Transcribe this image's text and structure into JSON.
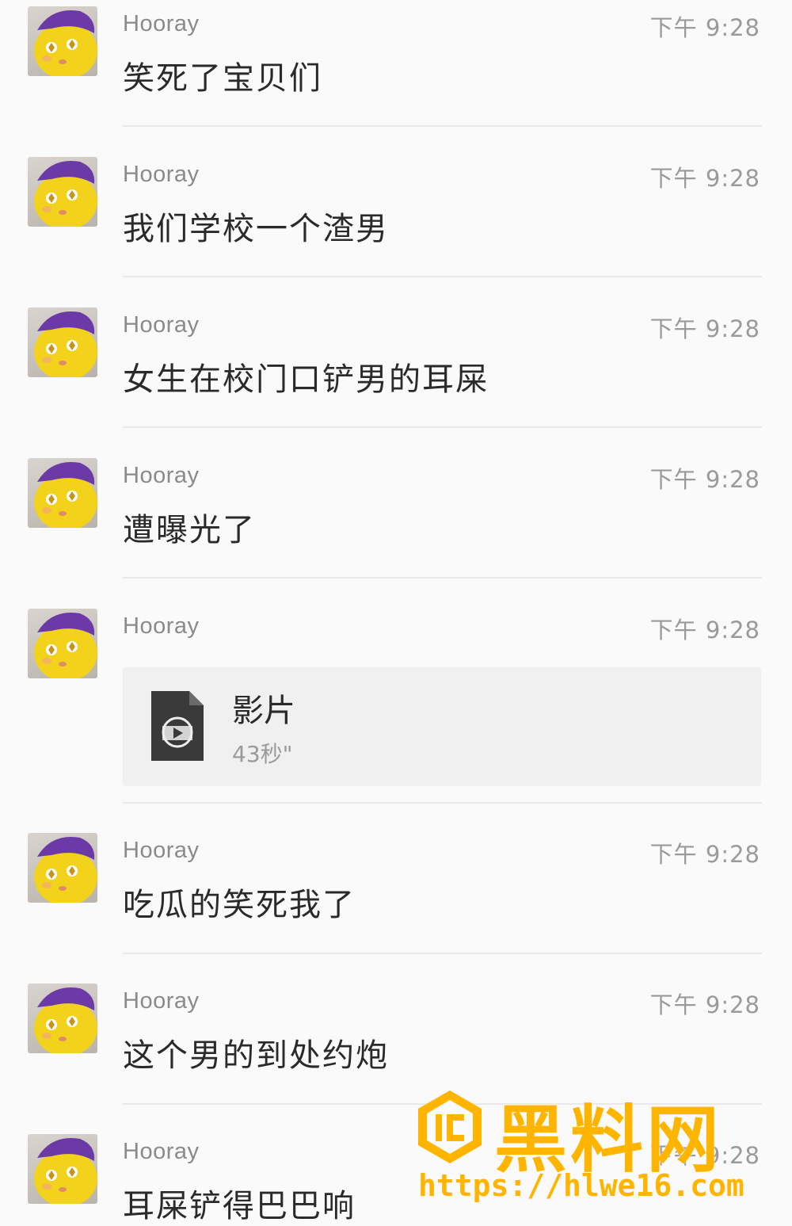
{
  "messages": [
    {
      "sender": "Hooray",
      "time": "下午 9:28",
      "text": "笑死了宝贝们"
    },
    {
      "sender": "Hooray",
      "time": "下午 9:28",
      "text": "我们学校一个渣男"
    },
    {
      "sender": "Hooray",
      "time": "下午 9:28",
      "text": "女生在校门口铲男的耳屎"
    },
    {
      "sender": "Hooray",
      "time": "下午 9:28",
      "text": "遭曝光了"
    },
    {
      "sender": "Hooray",
      "time": "下午 9:28",
      "file": {
        "name": "影片",
        "duration": "43秒\"",
        "icon": "video-file-icon"
      }
    },
    {
      "sender": "Hooray",
      "time": "下午 9:28",
      "text": "吃瓜的笑死我了"
    },
    {
      "sender": "Hooray",
      "time": "下午 9:28",
      "text": "这个男的到处约炮"
    },
    {
      "sender": "Hooray",
      "time": "下午 9:28",
      "text": "耳屎铲得巴巴响"
    }
  ],
  "watermark": {
    "title": "黑料网",
    "url": "https://hlwe16.com",
    "color": "#ffb400"
  },
  "colors": {
    "background": "#fafafa",
    "sender": "#8a8a8a",
    "time": "#9a9a9a",
    "text": "#2a2a2a",
    "divider": "#e9e9e9",
    "file_card": "#f0f0f0"
  }
}
